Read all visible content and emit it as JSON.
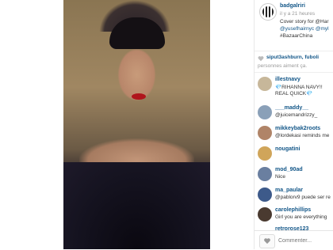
{
  "post": {
    "username": "badgalriri",
    "time": "il y a 21 heures",
    "caption_line1": "Cover story for @Har",
    "caption_line2": "@yusefhairnyc @myl",
    "caption_line3": "#BazaarChina"
  },
  "likes": {
    "names": "siput3ashburn, fuboli",
    "suffix": "personnes aiment ça."
  },
  "comments": [
    {
      "user": "illestnavy",
      "text": "💎RIHANNA NAVY!!",
      "text2": "REAL QUICK💎",
      "avatar_color": "#c7b79a"
    },
    {
      "user": "___maddy__",
      "text": "@juicemandrizzy_",
      "avatar_color": "#8aa0b8"
    },
    {
      "user": "mikkeybak2roots",
      "text": "@lordekasi reminds me",
      "avatar_color": "#b08468"
    },
    {
      "user": "nougatini",
      "text": "",
      "avatar_color": "#d0a55a"
    },
    {
      "user": "mod_90ad",
      "text": "Nice",
      "avatar_color": "#6a7fa0"
    },
    {
      "user": "ma_paular",
      "text": "@pablorv9 puede ser re",
      "avatar_color": "#3d5a8a"
    },
    {
      "user": "carolephillips",
      "text": "Girl you are everything",
      "avatar_color": "#4a3a30"
    },
    {
      "user": "retrorose123",
      "text": "",
      "avatar_color": "#9a7b6a"
    }
  ],
  "footer": {
    "comment_placeholder": "Commenter..."
  },
  "colors": {
    "link": "#125688",
    "text": "#333333"
  }
}
